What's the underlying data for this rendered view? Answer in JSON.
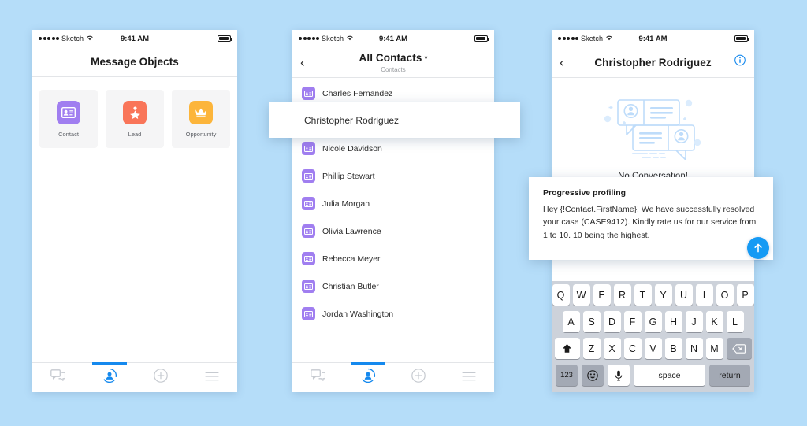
{
  "meta": {
    "background_color": "#b5ddf9",
    "accent_blue": "#1589ee",
    "purple": "#a07ef0",
    "orange": "#f97559",
    "amber": "#fcb53b"
  },
  "statusbar": {
    "carrier": "Sketch",
    "time": "9:41 AM"
  },
  "phone1": {
    "title": "Message Objects",
    "objects": [
      {
        "label": "Contact",
        "icon": "id-card-icon",
        "color": "#a07ef0"
      },
      {
        "label": "Lead",
        "icon": "lead-star-person-icon",
        "color": "#f97559"
      },
      {
        "label": "Opportunity",
        "icon": "crown-icon",
        "color": "#fcb53b"
      }
    ]
  },
  "phone2": {
    "title": "All Contacts",
    "subtitle": "Contacts",
    "caret": "▾",
    "back": "‹",
    "contacts": [
      {
        "name": "Charles Fernandez"
      },
      {
        "name": "Nicole Davidson"
      },
      {
        "name": "Phillip Stewart"
      },
      {
        "name": "Julia Morgan"
      },
      {
        "name": "Olivia Lawrence"
      },
      {
        "name": "Rebecca Meyer"
      },
      {
        "name": "Christian Butler"
      },
      {
        "name": "Jordan Washington"
      }
    ],
    "highlighted_contact": "Christopher Rodriguez"
  },
  "phone3": {
    "title": "Christopher Rodriguez",
    "back": "‹",
    "empty_state_text": "No Conversation!",
    "message": {
      "title": "Progressive profiling",
      "body": "Hey {!Contact.FirstName}! We have successfully resolved your case (CASE9412). Kindly rate us for our service from 1 to 10. 10 being the highest."
    },
    "keyboard": {
      "row1": [
        "Q",
        "W",
        "E",
        "R",
        "T",
        "Y",
        "U",
        "I",
        "O",
        "P"
      ],
      "row2": [
        "A",
        "S",
        "D",
        "F",
        "G",
        "H",
        "J",
        "K",
        "L"
      ],
      "row3": [
        "Z",
        "X",
        "C",
        "V",
        "B",
        "N",
        "M"
      ],
      "shift": "⬆",
      "backspace": "⌫",
      "numbers": "123",
      "emoji": "☺",
      "mic": "Ἲ4",
      "space": "space",
      "return": "return"
    }
  },
  "tabbar": {
    "items": [
      {
        "name": "messages",
        "icon": "chat-bubbles-icon",
        "active": false
      },
      {
        "name": "contacts",
        "icon": "contact-sync-icon",
        "active": true
      },
      {
        "name": "add",
        "icon": "plus-circle-icon",
        "active": false
      },
      {
        "name": "menu",
        "icon": "hamburger-menu-icon",
        "active": false
      }
    ]
  }
}
